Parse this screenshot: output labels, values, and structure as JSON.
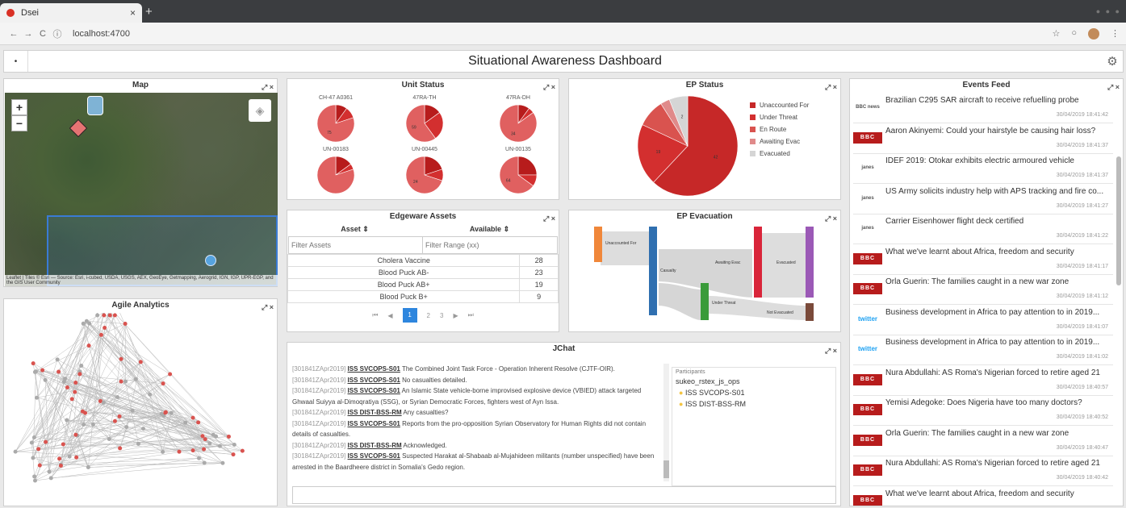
{
  "browser": {
    "tab_title": "Dsei",
    "tab_close": "×",
    "new_tab": "+",
    "url": "localhost:4700",
    "back": "←",
    "forward": "→",
    "reload": "C",
    "info": "ⓘ",
    "star": "☆"
  },
  "app": {
    "title": "Situational Awareness Dashboard",
    "menu_icon": "•",
    "gear": "⚙"
  },
  "panel_icons": {
    "expand": "⤢",
    "close": "×"
  },
  "map": {
    "title": "Map",
    "zoom_in": "+",
    "zoom_out": "−",
    "attribution": "Leaflet | Tiles © Esri — Source: Esri, i-cubed, USDA, USGS, AEX, GeoEye, Getmapping, Aerogrid, IGN, IGP, UPR-EGP, and the GIS User Community"
  },
  "analytics": {
    "title": "Agile Analytics"
  },
  "unit_status": {
    "title": "Unit Status",
    "units": [
      {
        "name": "CH-47 A0361",
        "slices": [
          {
            "label": "",
            "v": 0.1
          },
          {
            "label": "",
            "v": 0.1
          },
          {
            "label": "75",
            "v": 0.8
          }
        ]
      },
      {
        "name": "47RA-TH",
        "slices": [
          {
            "label": "",
            "v": 0.15
          },
          {
            "label": "",
            "v": 0.25
          },
          {
            "label": "59",
            "v": 0.6
          }
        ]
      },
      {
        "name": "47RA-DH",
        "slices": [
          {
            "label": "",
            "v": 0.1
          },
          {
            "label": "",
            "v": 0.05
          },
          {
            "label": "34",
            "v": 0.85
          }
        ]
      },
      {
        "name": "UN-00183",
        "slices": [
          {
            "label": "",
            "v": 0.15
          },
          {
            "label": "",
            "v": 0.05
          },
          {
            "label": "",
            "v": 0.8
          }
        ]
      },
      {
        "name": "UN-00445",
        "slices": [
          {
            "label": "",
            "v": 0.2
          },
          {
            "label": "",
            "v": 0.1
          },
          {
            "label": "24",
            "v": 0.7
          }
        ]
      },
      {
        "name": "UN-00135",
        "slices": [
          {
            "label": "",
            "v": 0.25
          },
          {
            "label": "",
            "v": 0.1
          },
          {
            "label": "64",
            "v": 0.65
          }
        ]
      }
    ]
  },
  "ep_status": {
    "title": "EP Status",
    "legend": [
      "Unaccounted For",
      "Under Threat",
      "En Route",
      "Awaiting Evac",
      "Evacuated"
    ],
    "colors": [
      "#c62828",
      "#d32f2f",
      "#d9534f",
      "#e08a8a",
      "#d5d5d5"
    ],
    "slices": [
      {
        "label": "42",
        "v": 0.62
      },
      {
        "label": "19",
        "v": 0.2
      },
      {
        "label": "",
        "v": 0.09
      },
      {
        "label": "",
        "v": 0.03
      },
      {
        "label": "2",
        "v": 0.06
      }
    ]
  },
  "edgeware": {
    "title": "Edgeware Assets",
    "col_asset": "Asset",
    "col_available": "Available",
    "sort": "⇕",
    "filter_asset": "Filter Assets",
    "filter_range": "Filter Range (xx)",
    "rows": [
      {
        "asset": "Cholera Vaccine",
        "available": "28"
      },
      {
        "asset": "Blood Puck AB-",
        "available": "23"
      },
      {
        "asset": "Blood Puck AB+",
        "available": "19"
      },
      {
        "asset": "Blood Puck B+",
        "available": "9"
      }
    ],
    "pager": [
      "⏮",
      "◀",
      "1",
      "2",
      "3",
      "▶",
      "⏭"
    ]
  },
  "ep_evac": {
    "title": "EP Evacuation",
    "nodes": [
      "Unaccounted For",
      "Casualty",
      "Awaiting Evac",
      "Evacuated",
      "Under Threat",
      "Not Evacuated"
    ]
  },
  "jchat": {
    "title": "JChat",
    "participants_label": "Participants",
    "participants": [
      "sukeo_rstex_js_ops",
      "ISS SVCOPS-S01",
      "ISS DIST-BSS-RM"
    ],
    "messages": [
      {
        "ts": "[301841ZApr2019]",
        "user": "ISS SVCOPS-S01",
        "text": " The Combined Joint Task Force - Operation Inherent Resolve (CJTF-OIR)."
      },
      {
        "ts": "[301841ZApr2019]",
        "user": "ISS SVCOPS-S01",
        "text": " No casualties detailed."
      },
      {
        "ts": "[301841ZApr2019]",
        "user": "ISS SVCOPS-S01",
        "text": " An Islamic State vehicle-borne improvised explosive device (VBIED) attack targeted Ghwaal Suiyya al-Dimoqratiya (SSG), or Syrian Democratic Forces, fighters west of Ayn Issa."
      },
      {
        "ts": "[301841ZApr2019]",
        "user": "ISS DIST-BSS-RM",
        "text": " Any casualties?"
      },
      {
        "ts": "[301841ZApr2019]",
        "user": "ISS SVCOPS-S01",
        "text": " Reports from the pro-opposition Syrian Observatory for Human Rights did not contain details of casualties."
      },
      {
        "ts": "[301841ZApr2019]",
        "user": "ISS DIST-BSS-RM",
        "text": " Acknowledged."
      },
      {
        "ts": "[301841ZApr2019]",
        "user": "ISS SVCOPS-S01",
        "text": " Suspected Harakat al-Shabaab al-Mujahideen militants (number unspecified) have been arrested in the Baardheere district in Somalia's Gedo region."
      }
    ]
  },
  "events": {
    "title": "Events Feed",
    "items": [
      {
        "src": "txt",
        "logo": "BBC news",
        "title": "Brazilian C295 SAR aircraft to receive refuelling probe",
        "date": "30/04/2019 18:41:42"
      },
      {
        "src": "bbc",
        "logo": "BBC",
        "title": "Aaron Akinyemi: Could your hairstyle be causing hair loss?",
        "date": "30/04/2019 18:41:37"
      },
      {
        "src": "txt",
        "logo": "janes",
        "title": "IDEF 2019: Otokar exhibits electric armoured vehicle",
        "date": "30/04/2019 18:41:37"
      },
      {
        "src": "txt",
        "logo": "janes",
        "title": "US Army solicits industry help with APS tracking and fire co...",
        "date": "30/04/2019 18:41:27"
      },
      {
        "src": "txt",
        "logo": "janes",
        "title": "Carrier Eisenhower flight deck certified",
        "date": "30/04/2019 18:41:22"
      },
      {
        "src": "bbc",
        "logo": "BBC",
        "title": "What we've learnt about Africa, freedom and security",
        "date": "30/04/2019 18:41:17"
      },
      {
        "src": "bbc",
        "logo": "BBC",
        "title": "Orla Guerin: The families caught in a new war zone",
        "date": "30/04/2019 18:41:12"
      },
      {
        "src": "tw",
        "logo": "twitter",
        "title": "Business development in Africa to pay attention to in 2019...",
        "date": "30/04/2019 18:41:07"
      },
      {
        "src": "tw",
        "logo": "twitter",
        "title": "Business development in Africa to pay attention to in 2019...",
        "date": "30/04/2019 18:41:02"
      },
      {
        "src": "bbc",
        "logo": "BBC",
        "title": "Nura Abdullahi: AS Roma's Nigerian forced to retire aged 21",
        "date": "30/04/2019 18:40:57"
      },
      {
        "src": "bbc",
        "logo": "BBC",
        "title": "Yemisi Adegoke: Does Nigeria have too many doctors?",
        "date": "30/04/2019 18:40:52"
      },
      {
        "src": "bbc",
        "logo": "BBC",
        "title": "Orla Guerin: The families caught in a new war zone",
        "date": "30/04/2019 18:40:47"
      },
      {
        "src": "bbc",
        "logo": "BBC",
        "title": "Nura Abdullahi: AS Roma's Nigerian forced to retire aged 21",
        "date": "30/04/2019 18:40:42"
      },
      {
        "src": "bbc",
        "logo": "BBC",
        "title": "What we've learnt about Africa, freedom and security",
        "date": ""
      }
    ]
  }
}
